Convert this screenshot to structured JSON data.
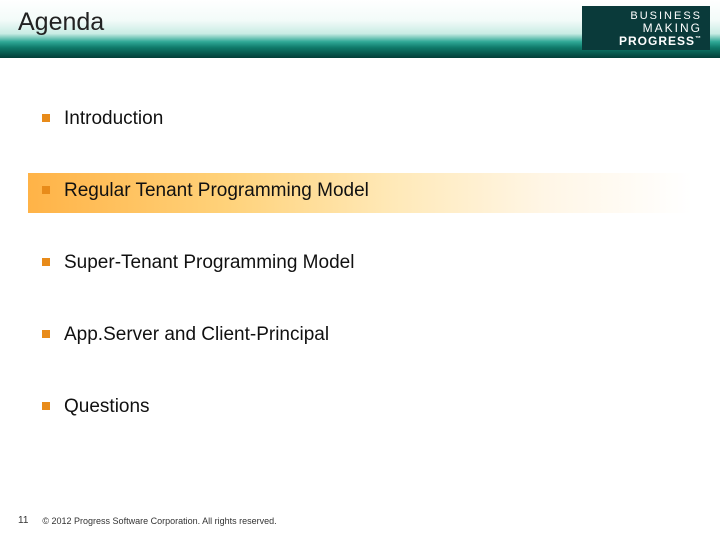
{
  "slide": {
    "title": "Agenda",
    "page_number": "11",
    "copyright": "© 2012 Progress Software Corporation. All rights reserved."
  },
  "logo": {
    "line1": "BUSINESS",
    "line2": "MAKING",
    "line3": "PROGRESS",
    "tm": "™"
  },
  "colors": {
    "bullet": "#e88b1a",
    "header_teal_dark": "#033e38",
    "highlight_orange": "#ffb347"
  },
  "agenda": {
    "items": [
      {
        "label": "Introduction",
        "highlighted": false
      },
      {
        "label": "Regular Tenant Programming Model",
        "highlighted": true
      },
      {
        "label": "Super-Tenant Programming Model",
        "highlighted": false
      },
      {
        "label": "App.Server and Client-Principal",
        "highlighted": false
      },
      {
        "label": "Questions",
        "highlighted": false
      }
    ]
  }
}
